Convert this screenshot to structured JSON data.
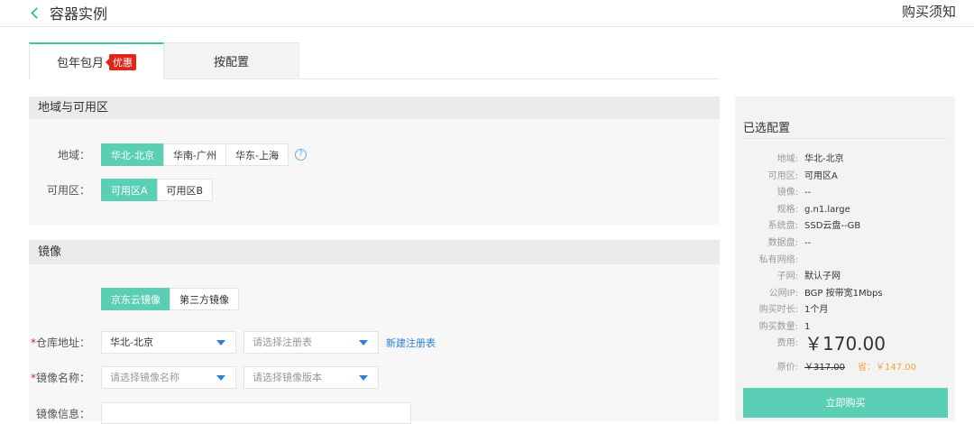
{
  "header": {
    "title": "容器实例",
    "notice": "购买须知"
  },
  "tabs": [
    {
      "label": "包年包月",
      "badge": "优惠"
    },
    {
      "label": "按配置"
    }
  ],
  "region_section": {
    "title": "地域与可用区",
    "region_label": "地域：",
    "regions": [
      "华北-北京",
      "华南-广州",
      "华东-上海"
    ],
    "help": "?",
    "zone_label": "可用区：",
    "zones": [
      "可用区A",
      "可用区B"
    ]
  },
  "image_section": {
    "title": "镜像",
    "sources": [
      "京东云镜像",
      "第三方镜像"
    ],
    "repo_label": "仓库地址：",
    "repo_value": "华北-北京",
    "registry_placeholder": "请选择注册表",
    "new_registry": "新建注册表",
    "name_label": "镜像名称：",
    "name_placeholder": "请选择镜像名称",
    "version_placeholder": "请选择镜像版本",
    "info_label": "镜像信息：",
    "required_mark": "*"
  },
  "summary": {
    "title": "已选配置",
    "items": [
      {
        "k": "地域:",
        "v": "华北-北京"
      },
      {
        "k": "可用区:",
        "v": "可用区A"
      },
      {
        "k": "镜像:",
        "v": "--"
      },
      {
        "k": "规格:",
        "v": "g.n1.large"
      },
      {
        "k": "系统盘:",
        "v": "SSD云盘--GB"
      },
      {
        "k": "数据盘:",
        "v": "--"
      },
      {
        "k": "私有网络:",
        "v": ""
      },
      {
        "k": "子网:",
        "v": "默认子网"
      },
      {
        "k": "公网IP:",
        "v": "BGP 按带宽1Mbps"
      },
      {
        "k": "购买时长:",
        "v": "1个月"
      },
      {
        "k": "购买数量:",
        "v": "1"
      }
    ],
    "fee_label": "费用:",
    "fee": "￥170.00",
    "orig_label": "原价:",
    "orig": "￥317.00",
    "save": "省：￥147.00",
    "buy": "立即购买"
  },
  "colors": {
    "accent": "#5bcfb5",
    "price": "#f6a13a",
    "badge": "#e1251b",
    "link": "#2e7fd8"
  }
}
